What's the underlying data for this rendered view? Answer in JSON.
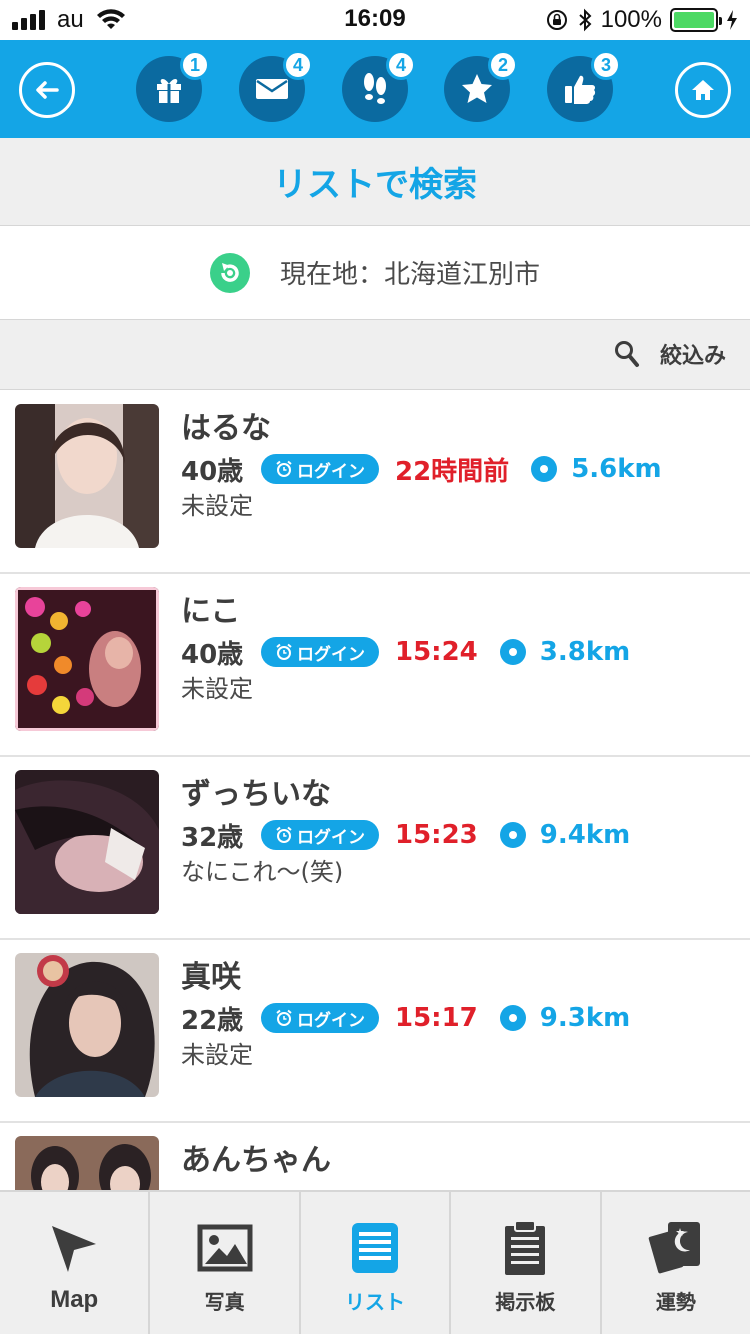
{
  "status": {
    "carrier": "au",
    "time": "16:09",
    "battery": "100%"
  },
  "header": {
    "badges": {
      "gift": "1",
      "mail": "4",
      "footprints": "4",
      "star": "2",
      "like": "3"
    },
    "icons": [
      "back-icon",
      "gift-icon",
      "mail-icon",
      "footprints-icon",
      "star-icon",
      "thumbs-up-icon",
      "home-icon"
    ]
  },
  "page": {
    "title": "リストで検索"
  },
  "location": {
    "text": "現在地：北海道江別市"
  },
  "filter": {
    "label": "絞込み"
  },
  "users": [
    {
      "name": "はるな",
      "age": "40歳",
      "login": "ログイン",
      "time": "22時間前",
      "distance": "5.6km",
      "comment": "未設定"
    },
    {
      "name": "にこ",
      "age": "40歳",
      "login": "ログイン",
      "time": "15:24",
      "distance": "3.8km",
      "comment": "未設定"
    },
    {
      "name": "ずっちいな",
      "age": "32歳",
      "login": "ログイン",
      "time": "15:23",
      "distance": "9.4km",
      "comment": "なにこれ〜(笑)"
    },
    {
      "name": "真咲",
      "age": "22歳",
      "login": "ログイン",
      "time": "15:17",
      "distance": "9.3km",
      "comment": "未設定"
    },
    {
      "name": "あんちゃん",
      "age": "",
      "login": "",
      "time": "",
      "distance": "",
      "comment": ""
    }
  ],
  "tabs": {
    "map": "Map",
    "photo": "写真",
    "list": "リスト",
    "board": "掲示板",
    "fortune": "運勢",
    "active": "list"
  },
  "colors": {
    "accent": "#14a5e6",
    "time_red": "#e0202a",
    "refresh_green": "#3ad08a"
  }
}
